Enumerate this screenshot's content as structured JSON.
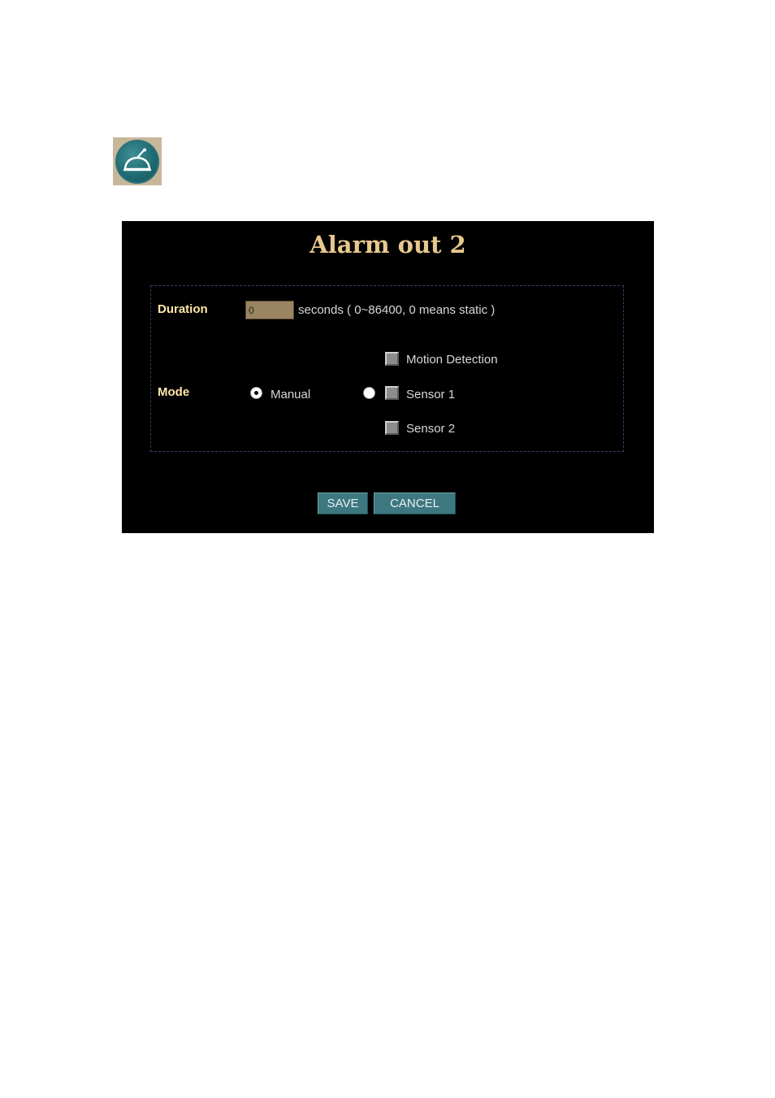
{
  "icon": "alarm-bell-icon",
  "panel": {
    "title": "Alarm out 2",
    "duration": {
      "label": "Duration",
      "value": "0",
      "hint": "seconds ( 0~86400, 0 means static )"
    },
    "mode": {
      "label": "Mode",
      "manual_label": "Manual",
      "manual_selected": true,
      "options": [
        {
          "label": "Motion Detection",
          "checked": false
        },
        {
          "label": "Sensor 1",
          "checked": false
        },
        {
          "label": "Sensor 2",
          "checked": false
        }
      ]
    },
    "buttons": {
      "save": "SAVE",
      "cancel": "CANCEL"
    }
  },
  "colors": {
    "title": "#e8c88e",
    "label": "#ffe8a8",
    "button": "#3d7880"
  }
}
